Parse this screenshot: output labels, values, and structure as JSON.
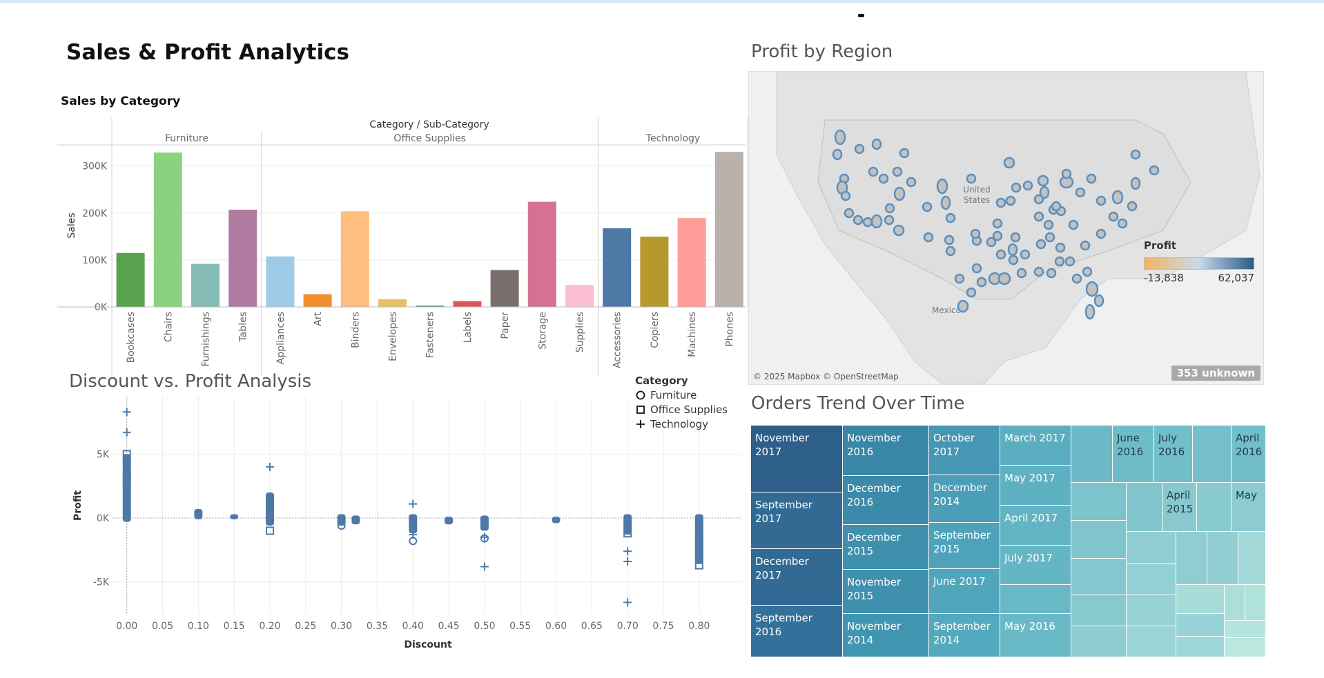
{
  "dashboard": {
    "title": "Sales & Profit Analytics"
  },
  "sales_chart": {
    "title": "Sales by Category",
    "header": "Category / Sub-Category",
    "categories": [
      {
        "name": "Furniture",
        "subs": [
          {
            "name": "Bookcases",
            "value": 114880,
            "color": "#59a14f"
          },
          {
            "name": "Chairs",
            "value": 328449,
            "color": "#8cd17d"
          },
          {
            "name": "Furnishings",
            "value": 91705,
            "color": "#86bcb6"
          },
          {
            "name": "Tables",
            "value": 206966,
            "color": "#b07aa1"
          }
        ]
      },
      {
        "name": "Office Supplies",
        "subs": [
          {
            "name": "Appliances",
            "value": 107532,
            "color": "#a0cbe8"
          },
          {
            "name": "Art",
            "value": 27119,
            "color": "#f28e2b"
          },
          {
            "name": "Binders",
            "value": 203413,
            "color": "#ffbe7d"
          },
          {
            "name": "Envelopes",
            "value": 16476,
            "color": "#e9c05f"
          },
          {
            "name": "Fasteners",
            "value": 3024,
            "color": "#499894"
          },
          {
            "name": "Labels",
            "value": 12486,
            "color": "#e15759"
          },
          {
            "name": "Paper",
            "value": 78479,
            "color": "#79706e"
          },
          {
            "name": "Storage",
            "value": 223844,
            "color": "#d37295"
          },
          {
            "name": "Supplies",
            "value": 46674,
            "color": "#fabfd2"
          }
        ]
      },
      {
        "name": "Technology",
        "subs": [
          {
            "name": "Accessories",
            "value": 167380,
            "color": "#4e79a7"
          },
          {
            "name": "Copiers",
            "value": 149528,
            "color": "#b6992d"
          },
          {
            "name": "Machines",
            "value": 189239,
            "color": "#ff9d9a"
          },
          {
            "name": "Phones",
            "value": 330007,
            "color": "#bab0ac"
          }
        ]
      }
    ],
    "ylabel": "Sales",
    "yticks": [
      {
        "value": 0,
        "label": "0K"
      },
      {
        "value": 100000,
        "label": "100K"
      },
      {
        "value": 200000,
        "label": "200K"
      },
      {
        "value": 300000,
        "label": "300K"
      }
    ],
    "ymax": 345000
  },
  "map": {
    "title": "Profit by Region",
    "label_us": "United\nStates",
    "label_mexico": "Mexico",
    "copyright": "© 2025 Mapbox © OpenStreetMap",
    "unknown": "353 unknown",
    "legend": {
      "title": "Profit",
      "min_label": "-13,838",
      "max_label": "62,037",
      "min_color": "#f5b363",
      "mid_color": "#c6dbea",
      "max_color": "#2c5985"
    }
  },
  "chart_data": [
    {
      "type": "scatter",
      "title": "Discount vs. Profit Analysis",
      "xlabel": "Discount",
      "ylabel": "Profit",
      "xlim": [
        -0.02,
        0.86
      ],
      "ylim": [
        -7.5,
        9.5
      ],
      "xticks": [
        "0.00",
        "0.05",
        "0.10",
        "0.15",
        "0.20",
        "0.25",
        "0.30",
        "0.35",
        "0.40",
        "0.45",
        "0.50",
        "0.55",
        "0.60",
        "0.65",
        "0.70",
        "0.75",
        "0.80"
      ],
      "yticks": [
        {
          "value": 5,
          "label": "5K"
        },
        {
          "value": 0,
          "label": "0K"
        },
        {
          "value": -5,
          "label": "-5K"
        }
      ],
      "legend": {
        "title": "Category",
        "items": [
          {
            "name": "Furniture",
            "shape": "circle"
          },
          {
            "name": "Office Supplies",
            "shape": "square"
          },
          {
            "name": "Technology",
            "shape": "plus"
          }
        ]
      },
      "color": "#4e79a7",
      "columns": [
        {
          "x": 0.0,
          "min": -0.3,
          "max": 5.0
        },
        {
          "x": 0.1,
          "min": -0.1,
          "max": 0.7
        },
        {
          "x": 0.15,
          "min": -0.1,
          "max": 0.3
        },
        {
          "x": 0.2,
          "min": -0.6,
          "max": 2.0
        },
        {
          "x": 0.3,
          "min": -0.6,
          "max": 0.3
        },
        {
          "x": 0.32,
          "min": -0.5,
          "max": 0.2
        },
        {
          "x": 0.4,
          "min": -1.2,
          "max": 0.3
        },
        {
          "x": 0.45,
          "min": -0.5,
          "max": 0.1
        },
        {
          "x": 0.5,
          "min": -1.0,
          "max": 0.2
        },
        {
          "x": 0.6,
          "min": -0.4,
          "max": 0.1
        },
        {
          "x": 0.7,
          "min": -1.3,
          "max": 0.3
        },
        {
          "x": 0.8,
          "min": -3.6,
          "max": 0.3
        }
      ],
      "points": [
        {
          "x": 0.0,
          "y": 8.3,
          "shape": "plus"
        },
        {
          "x": 0.0,
          "y": 6.7,
          "shape": "plus"
        },
        {
          "x": 0.0,
          "y": 5.0,
          "shape": "square"
        },
        {
          "x": 0.0,
          "y": 3.1,
          "shape": "square"
        },
        {
          "x": 0.0,
          "y": 2.5,
          "shape": "circle"
        },
        {
          "x": 0.2,
          "y": 4.0,
          "shape": "plus"
        },
        {
          "x": 0.2,
          "y": -1.0,
          "shape": "square"
        },
        {
          "x": 0.3,
          "y": -0.6,
          "shape": "circle"
        },
        {
          "x": 0.4,
          "y": 1.1,
          "shape": "plus"
        },
        {
          "x": 0.4,
          "y": -1.8,
          "shape": "circle"
        },
        {
          "x": 0.4,
          "y": -1.3,
          "shape": "plus"
        },
        {
          "x": 0.5,
          "y": -1.6,
          "shape": "circle"
        },
        {
          "x": 0.5,
          "y": -1.5,
          "shape": "plus"
        },
        {
          "x": 0.5,
          "y": -3.8,
          "shape": "plus"
        },
        {
          "x": 0.7,
          "y": -2.6,
          "shape": "plus"
        },
        {
          "x": 0.7,
          "y": -3.4,
          "shape": "plus"
        },
        {
          "x": 0.7,
          "y": -6.6,
          "shape": "plus"
        },
        {
          "x": 0.7,
          "y": -1.2,
          "shape": "square"
        },
        {
          "x": 0.8,
          "y": -1.5,
          "shape": "square"
        },
        {
          "x": 0.8,
          "y": -2.0,
          "shape": "square"
        },
        {
          "x": 0.8,
          "y": -2.5,
          "shape": "square"
        },
        {
          "x": 0.8,
          "y": -3.1,
          "shape": "square"
        },
        {
          "x": 0.8,
          "y": -3.7,
          "shape": "square"
        }
      ]
    }
  ],
  "treemap": {
    "title": "Orders Trend Over Time",
    "cells": [
      {
        "label": "November 2017",
        "color": "#2d5f8a"
      },
      {
        "label": "September 2017",
        "color": "#326a93"
      },
      {
        "label": "December 2017",
        "color": "#326a93"
      },
      {
        "label": "September 2016",
        "color": "#34719a"
      },
      {
        "label": "November 2016",
        "color": "#3a86a6"
      },
      {
        "label": "December 2016",
        "color": "#3b8aaa"
      },
      {
        "label": "December 2015",
        "color": "#3e90ad"
      },
      {
        "label": "November 2015",
        "color": "#3e90ad"
      },
      {
        "label": "November 2014",
        "color": "#4096b1"
      },
      {
        "label": "October 2017",
        "color": "#4597b3"
      },
      {
        "label": "December 2014",
        "color": "#4a9eb7"
      },
      {
        "label": "September 2015",
        "color": "#4ea3ba"
      },
      {
        "label": "June 2017",
        "color": "#51a6bc"
      },
      {
        "label": "September 2014",
        "color": "#53a9be"
      },
      {
        "label": "March 2017",
        "color": "#5aaec0"
      },
      {
        "label": "May 2017",
        "color": "#5db1c2"
      },
      {
        "label": "April 2017",
        "color": "#62b4c4"
      },
      {
        "label": "July 2017",
        "color": "#65b6c5"
      },
      {
        "label": "",
        "color": "#68b8c6"
      },
      {
        "label": "May 2016",
        "color": "#6ab9c7"
      },
      {
        "label": "",
        "color": "#6cbac8"
      },
      {
        "label": "June 2016",
        "color": "#6fbcc9"
      },
      {
        "label": "July 2016",
        "color": "#72beca"
      },
      {
        "label": "",
        "color": "#75bfcb"
      },
      {
        "label": "April 2016",
        "color": "#72beca"
      },
      {
        "label": "",
        "color": "#7cc3cc"
      },
      {
        "label": "",
        "color": "#80c5cd"
      },
      {
        "label": "April 2015",
        "color": "#87c9cf"
      },
      {
        "label": "",
        "color": "#89cad0"
      },
      {
        "label": "May",
        "color": "#8ccbd1"
      },
      {
        "label": "",
        "color": "#80c5cd"
      },
      {
        "label": "",
        "color": "#84c7ce"
      },
      {
        "label": "",
        "color": "#88c9cf"
      },
      {
        "label": "",
        "color": "#8dccd1"
      },
      {
        "label": "",
        "color": "#90ced2"
      },
      {
        "label": "",
        "color": "#93d0d3"
      },
      {
        "label": "",
        "color": "#96d2d4"
      },
      {
        "label": "",
        "color": "#9ad4d5"
      },
      {
        "label": "",
        "color": "#8fcdd2"
      },
      {
        "label": "",
        "color": "#92cfd3"
      },
      {
        "label": "",
        "color": "#a2d9d8"
      },
      {
        "label": "",
        "color": "#a7dcd9"
      },
      {
        "label": "",
        "color": "#98d3d5"
      },
      {
        "label": "",
        "color": "#9ed7d7"
      },
      {
        "label": "",
        "color": "#acdfdb"
      },
      {
        "label": "",
        "color": "#b0e2dc"
      },
      {
        "label": "",
        "color": "#b5e5de"
      },
      {
        "label": "",
        "color": "#bae8e0"
      },
      {
        "label": "",
        "color": "#bde9e1"
      }
    ]
  }
}
